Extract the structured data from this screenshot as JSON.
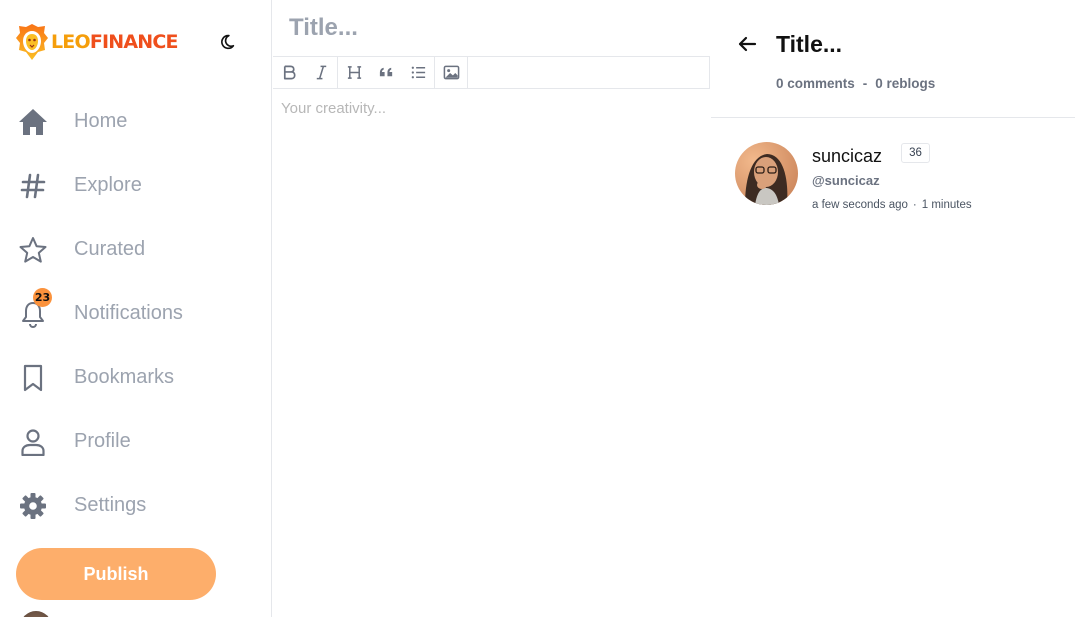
{
  "brand": {
    "logo_text_1": "LEO",
    "logo_text_2": "FINANCE",
    "colors": {
      "accent": "#fdae6b",
      "leo": "#f59e0b",
      "finance": "#ef4f1c",
      "badge": "#fb923c"
    }
  },
  "header": {
    "theme_toggle_icon": "moon-icon"
  },
  "sidebar": {
    "items": [
      {
        "label": "Home",
        "icon": "home-icon"
      },
      {
        "label": "Explore",
        "icon": "hashtag-icon"
      },
      {
        "label": "Curated",
        "icon": "star-icon"
      },
      {
        "label": "Notifications",
        "icon": "bell-icon",
        "badge": "23"
      },
      {
        "label": "Bookmarks",
        "icon": "bookmark-icon"
      },
      {
        "label": "Profile",
        "icon": "user-icon"
      },
      {
        "label": "Settings",
        "icon": "gear-icon"
      }
    ],
    "publish_label": "Publish"
  },
  "editor": {
    "title_placeholder": "Title...",
    "body_placeholder": "Your creativity...",
    "toolbar": [
      "bold-icon",
      "italic-icon",
      "heading-icon",
      "quote-icon",
      "list-icon",
      "image-icon"
    ]
  },
  "preview": {
    "title": "Title...",
    "comments": "0 comments",
    "separator": "-",
    "reblogs": "0 reblogs",
    "author": {
      "name": "suncicaz",
      "reputation": "36",
      "handle": "@suncicaz",
      "time": "a few seconds ago",
      "time_separator": "·",
      "read_time": "1 minutes"
    }
  }
}
